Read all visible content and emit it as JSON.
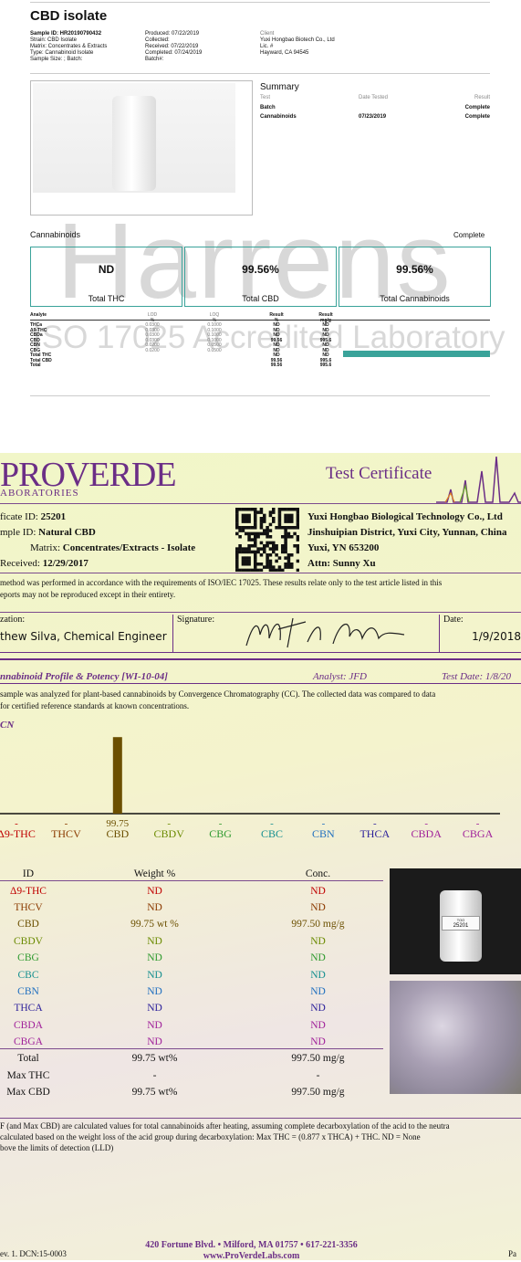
{
  "colors": {
    "teal": "#3aa39a",
    "purple": "#6b2e86",
    "brown": "#6b4f00",
    "red": "#c00000"
  },
  "isolate": {
    "title": "CBD isolate",
    "col1": [
      "Sample ID: HR20190790432",
      "Strain: CBD Isolate",
      "Matrix: Concentrates & Extracts",
      "Type: Cannabinoid Isolate",
      "Sample Size: ; Batch:"
    ],
    "col2": [
      "Produced: 07/22/2019",
      "Collected:",
      "Received: 07/22/2019",
      "Completed: 07/24/2019",
      "Batch#:"
    ],
    "col3": [
      "Client",
      "Yuxi Hongbao Biotech Co., Ltd",
      "Lic. #",
      "",
      "Hayward, CA 94545"
    ],
    "summary_title": "Summary",
    "summary_headers": [
      "Test",
      "Date Tested",
      "Result"
    ],
    "summary_rows": [
      [
        "Batch",
        "",
        "Complete"
      ],
      [
        "Cannabinoids",
        "07/23/2019",
        "Complete"
      ]
    ],
    "section_label": "Cannabinoids",
    "section_status": "Complete",
    "boxes": [
      {
        "value": "ND",
        "label": "Total THC"
      },
      {
        "value": "99.56%",
        "label": "Total CBD"
      },
      {
        "value": "99.56%",
        "label": "Total Cannabinoids"
      }
    ],
    "watermark_big": "Harrens",
    "watermark_small": "ISO 17025 Accredited Laboratory",
    "table_headers": [
      "Analyte",
      "LOD",
      "LOQ",
      "Result",
      "Result"
    ],
    "table_units": [
      "",
      "%",
      "%",
      "%",
      "mg/g"
    ],
    "table_rows": [
      [
        "THCa",
        "0.0300",
        "0.1000",
        "ND",
        "ND"
      ],
      [
        "Δ9-THC",
        "0.0300",
        "0.1000",
        "ND",
        "ND"
      ],
      [
        "CBDa",
        "0.0300",
        "0.1000",
        "ND",
        "ND"
      ],
      [
        "CBD",
        "0.0300",
        "0.1000",
        "99.56",
        "995.6"
      ],
      [
        "CBN",
        "0.0200",
        "0.0500",
        "ND",
        "ND"
      ],
      [
        "CBG",
        "0.0200",
        "0.0500",
        "ND",
        "ND"
      ],
      [
        "Total THC",
        "",
        "",
        "ND",
        "ND"
      ],
      [
        "Total CBD",
        "",
        "",
        "99.56",
        "995.6"
      ],
      [
        "Total",
        "",
        "",
        "99.56",
        "995.6"
      ]
    ]
  },
  "proverde": {
    "logo_main": "PROVERDE",
    "logo_sub": "ABORATORIES",
    "cert_title": "Test Certificate",
    "left_info": [
      {
        "k": "ficate ID:",
        "v": "25201"
      },
      {
        "k": "mple ID:",
        "v": "Natural CBD"
      },
      {
        "k": "Matrix:",
        "v": "Concentrates/Extracts - Isolate"
      },
      {
        "k": "Received:",
        "v": "12/29/2017"
      }
    ],
    "right_info": [
      "Yuxi Hongbao Biological Technology Co., Ltd",
      "Jinshuipian District, Yuxi City, Yunnan, China",
      "Yuxi, YN  653200",
      "Attn: Sunny Xu"
    ],
    "statement_1": "method was performed in accordance with the requirements of ISO/IEC 17025. These results relate only to the test article listed in this",
    "statement_2": "eports may not be reproduced except in their entirety.",
    "auth_label": "zation:",
    "auth_name": "thew Silva, Chemical Engineer",
    "sig_label": "Signature:",
    "date_label": "Date:",
    "date_value": "1/9/2018",
    "profile_title": "nnabinoid Profile & Potency [WI-10-04]",
    "analyst": "Analyst: JFD",
    "test_date": "Test Date: 1/8/20",
    "method_1": "sample was analyzed for plant-based cannabinoids by Convergence Chromatography (CC).  The collected data was compared to data",
    "method_2": "for certified reference standards at known concentrations.",
    "chart_corner": "CN",
    "table_header": [
      "ID",
      "Weight %",
      "Conc."
    ],
    "footnote_1": "F (and Max CBD) are calculated values for total cannabinoids after heating, assuming complete decarboxylation of the acid to the neutra",
    "footnote_2": "calculated based on the weight loss of the acid group during decarboxylation:   Max THC = (0.877 x THCA) + THC.  ND = None",
    "footnote_3": "bove the limits of detection (LLD)",
    "address": "420 Fortune Blvd. • Milford, MA 01757 • 617-221-3356",
    "website": "www.ProVerdeLabs.com",
    "rev": "ev. 1. DCN:15-0003",
    "page": "Pa",
    "vial_label": "25201"
  },
  "chart_data": {
    "type": "bar",
    "categories": [
      "Δ9-THC",
      "THCV",
      "CBD",
      "CBDV",
      "CBG",
      "CBC",
      "CBN",
      "THCA",
      "CBDA",
      "CBGA"
    ],
    "values": [
      0,
      0,
      99.75,
      0,
      0,
      0,
      0,
      0,
      0,
      0
    ],
    "value_labels": [
      "-",
      "-",
      "99.75",
      "-",
      "-",
      "-",
      "-",
      "-",
      "-",
      "-"
    ],
    "category_colors": [
      "#c00000",
      "#8b3a00",
      "#6b4f00",
      "#6a8a00",
      "#2e9a2e",
      "#148f8f",
      "#1f6fbf",
      "#2b1f9a",
      "#a0209a",
      "#a0209a"
    ],
    "title": "",
    "xlabel": "",
    "ylabel": "",
    "ylim": [
      0,
      100
    ]
  },
  "potency_rows": [
    {
      "id": "Δ9-THC",
      "w": "ND",
      "c": "ND",
      "color": "#c00000"
    },
    {
      "id": "THCV",
      "w": "ND",
      "c": "ND",
      "color": "#8b3a00"
    },
    {
      "id": "CBD",
      "w": "99.75 wt %",
      "c": "997.50 mg/g",
      "color": "#6b4f00"
    },
    {
      "id": "CBDV",
      "w": "ND",
      "c": "ND",
      "color": "#6a8a00"
    },
    {
      "id": "CBG",
      "w": "ND",
      "c": "ND",
      "color": "#2e9a2e"
    },
    {
      "id": "CBC",
      "w": "ND",
      "c": "ND",
      "color": "#148f8f"
    },
    {
      "id": "CBN",
      "w": "ND",
      "c": "ND",
      "color": "#1f6fbf"
    },
    {
      "id": "THCA",
      "w": "ND",
      "c": "ND",
      "color": "#2b1f9a"
    },
    {
      "id": "CBDA",
      "w": "ND",
      "c": "ND",
      "color": "#a0209a"
    },
    {
      "id": "CBGA",
      "w": "ND",
      "c": "ND",
      "color": "#a0209a"
    },
    {
      "id": "Total",
      "w": "99.75 wt%",
      "c": "997.50 mg/g",
      "color": "#111111"
    },
    {
      "id": "Max THC",
      "w": "-",
      "c": "-",
      "color": "#111111"
    },
    {
      "id": "Max CBD",
      "w": "99.75 wt%",
      "c": "997.50 mg/g",
      "color": "#111111"
    }
  ]
}
